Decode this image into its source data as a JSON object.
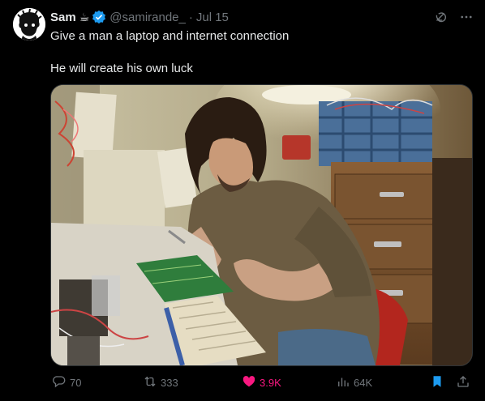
{
  "user": {
    "name": "Sam",
    "emoji": "☕",
    "handle": "@samirande_",
    "separator": "·",
    "date": "Jul 15"
  },
  "tweet": {
    "line1": "Give a man a laptop and internet connection",
    "line2": "He will create his own luck"
  },
  "actions": {
    "replies": "70",
    "reposts": "333",
    "likes": "3.9K",
    "views": "64K"
  },
  "colors": {
    "background": "#000000",
    "text": "#e7e9ea",
    "muted": "#71767b",
    "like": "#f91880",
    "verified": "#1d9bf0",
    "bookmark": "#1d9bf0"
  },
  "icons": [
    "grok-icon",
    "more-icon",
    "reply-icon",
    "repost-icon",
    "like-icon",
    "views-icon",
    "bookmark-icon",
    "share-icon"
  ]
}
